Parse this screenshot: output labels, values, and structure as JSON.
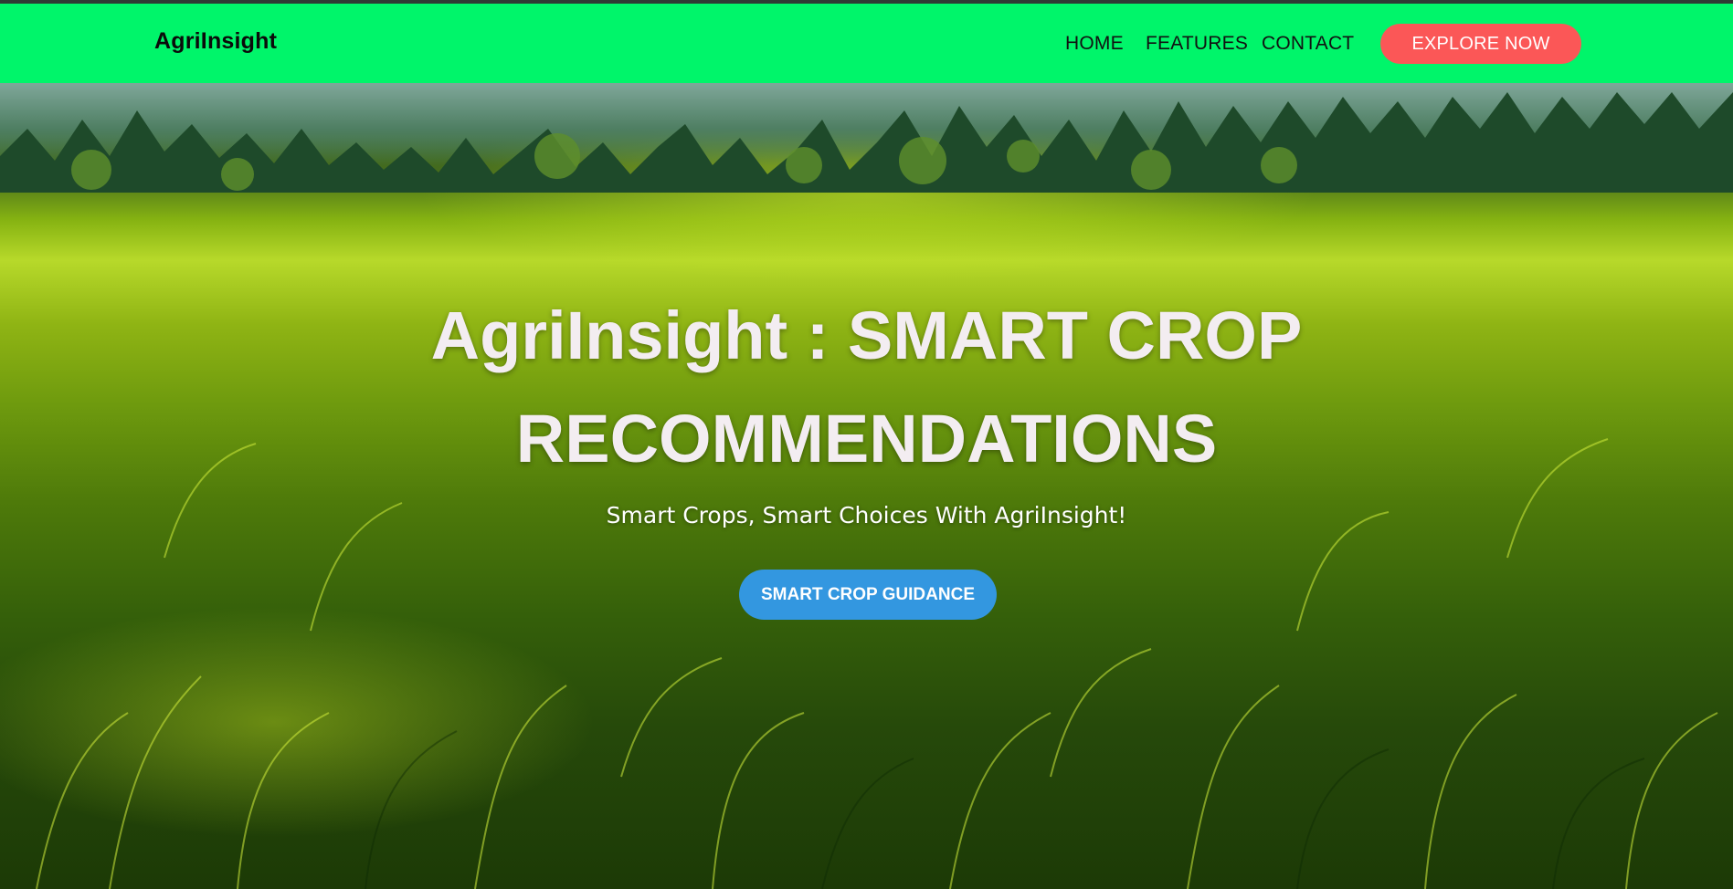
{
  "navbar": {
    "brand": "AgriInsight",
    "links": [
      "HOME",
      "FEATURES",
      "CONTACT"
    ],
    "cta_label": "EXPLORE NOW",
    "background_color": "#00f56a",
    "cta_color": "#fb5757"
  },
  "hero": {
    "title_line1": "AgriInsight : SMART CROP",
    "title_line2": "RECOMMENDATIONS",
    "subtitle": "Smart Crops, Smart Choices With AgriInsight!",
    "button_label": "SMART CROP GUIDANCE",
    "button_color": "#3397e0",
    "background": "green grass meadow with forest treeline"
  }
}
